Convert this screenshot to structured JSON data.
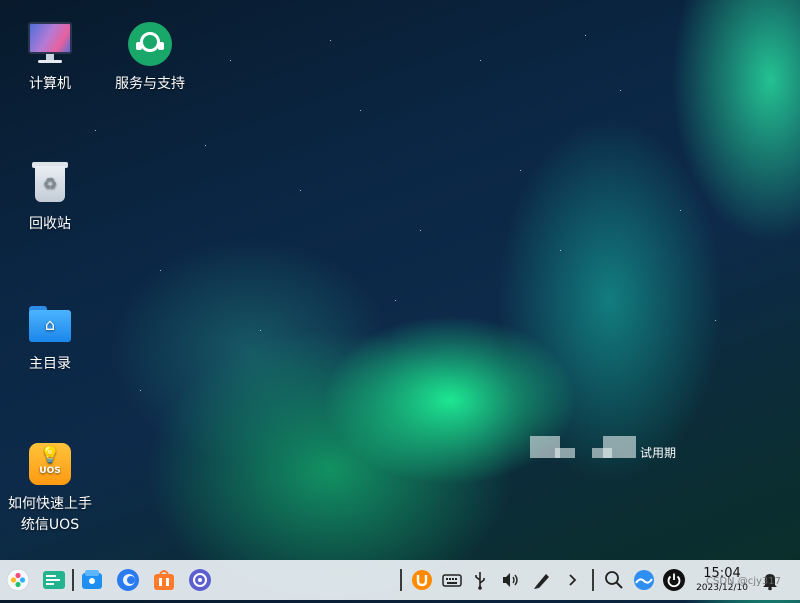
{
  "desktop": {
    "icons": [
      {
        "label": "计算机",
        "icon": "computer-icon"
      },
      {
        "label": "服务与支持",
        "icon": "support-icon"
      },
      {
        "label": "回收站",
        "icon": "trash-icon"
      },
      {
        "label": "主目录",
        "icon": "home-folder-icon"
      },
      {
        "label": "如何快速上手统信UOS",
        "icon": "uos-tips-icon"
      }
    ],
    "tips_icon_text": "UOS",
    "trial_label": "试用期"
  },
  "taskbar": {
    "left_apps": [
      {
        "name": "launcher",
        "icon": "launcher-icon"
      },
      {
        "name": "multitasking-view",
        "icon": "multitasking-icon"
      },
      {
        "name": "file-manager",
        "icon": "file-manager-icon"
      },
      {
        "name": "browser",
        "icon": "browser-icon"
      },
      {
        "name": "app-store",
        "icon": "app-store-icon"
      },
      {
        "name": "control-center",
        "icon": "control-center-icon"
      }
    ],
    "tray": [
      {
        "name": "input-method",
        "icon": "input-method-icon"
      },
      {
        "name": "onscreen-keyboard",
        "icon": "keyboard-icon"
      },
      {
        "name": "usb-device",
        "icon": "usb-icon"
      },
      {
        "name": "volume",
        "icon": "volume-icon"
      },
      {
        "name": "pen-tool",
        "icon": "pen-icon"
      },
      {
        "name": "expand-tray",
        "icon": "chevron-right-icon"
      },
      {
        "name": "search",
        "icon": "search-icon"
      },
      {
        "name": "browser-tray",
        "icon": "browser-tray-icon"
      },
      {
        "name": "power",
        "icon": "power-icon"
      },
      {
        "name": "notifications",
        "icon": "bell-icon"
      }
    ],
    "clock": {
      "time": "15:04",
      "date": "2023/12/10"
    },
    "watermark": "CSDN @cjy317"
  }
}
